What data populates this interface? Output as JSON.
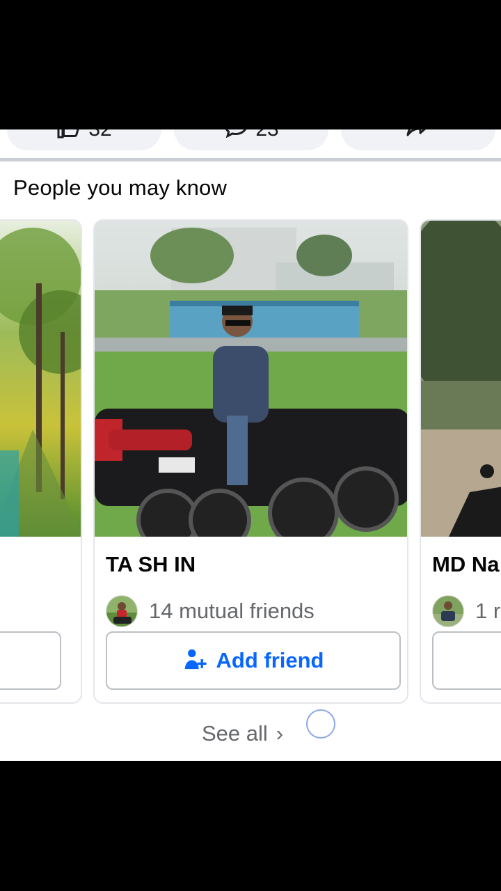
{
  "actions": {
    "like_count": "32",
    "comment_count": "23"
  },
  "section": {
    "title": "People you may know",
    "see_all_label": "See all",
    "see_all_chevron": "›"
  },
  "cards": [
    {
      "name": "",
      "mutual": "",
      "button_label": ""
    },
    {
      "name": "TA SH IN",
      "mutual": "14 mutual friends",
      "button_label": "Add friend"
    },
    {
      "name": "MD Na",
      "mutual": "1 r",
      "button_label": ""
    }
  ],
  "icons": {
    "like": "thumbs-up-icon",
    "comment": "comment-icon",
    "share": "share-icon",
    "add_friend": "add-person-icon",
    "see_all": "chevron-right-icon"
  },
  "colors": {
    "accent": "#0866ff",
    "muted_text": "#65676b",
    "divider": "#ccd0d5"
  }
}
